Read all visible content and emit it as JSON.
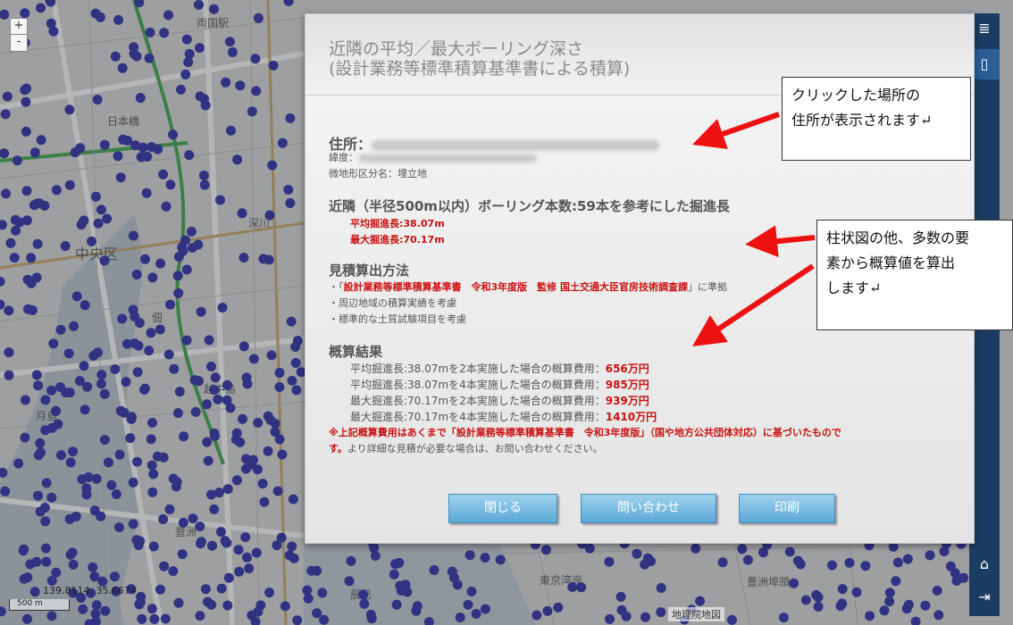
{
  "map": {
    "zoom_in": "+",
    "zoom_out": "-",
    "coordinates": "139.8114, 35.6674",
    "scale": "500 m",
    "attribution": "地理院地図",
    "labels": [
      "両国駅",
      "日本橋",
      "中央区",
      "深川",
      "佃",
      "月島",
      "越中島",
      "豊洲",
      "辰巳",
      "東京湾岸",
      "豊洲埠頭"
    ]
  },
  "sidebar": {
    "layers_icon": "≣",
    "mouse_icon": "▯",
    "home_icon": "⌂",
    "logout_icon": "⇥"
  },
  "dialog": {
    "title_line1": "近隣の平均／最大ボーリング深さ",
    "title_line2": "(設計業務等標準積算基準書による積算)",
    "address_label": "住所：",
    "latlon_label": "緯度：",
    "terrain_label": "微地形区分名：埋立地",
    "nearby_heading": "近隣（半径500m以内）ボーリング本数:59本を参考にした掘進長",
    "avg_depth": "平均掘進長:38.07m",
    "max_depth": "最大掘進長:70.17m",
    "method_heading": "見積算出方法",
    "method_items": [
      {
        "pre": "・「",
        "red": "設計業務等標準積算基準書　令和3年度版　監修 国土交通大臣官房技術調査課",
        "post": "」に準拠"
      },
      {
        "pre": "・周辺地域の積算実績を考慮",
        "red": "",
        "post": ""
      },
      {
        "pre": "・標準的な土質試験項目を考慮",
        "red": "",
        "post": ""
      }
    ],
    "result_heading": "概算結果",
    "results": [
      {
        "label": "平均掘進長:38.07mを2本実施した場合の概算費用：",
        "value": "656万円"
      },
      {
        "label": "平均掘進長:38.07mを4本実施した場合の概算費用：",
        "value": "985万円"
      },
      {
        "label": "最大掘進長:70.17mを2本実施した場合の概算費用：",
        "value": "939万円"
      },
      {
        "label": "最大掘進長:70.17mを4本実施した場合の概算費用：",
        "value": "1410万円"
      }
    ],
    "note_red_1": "※上記概算費用はあくまで「設計業務等標準積算基準書　令和3年度版」（国や地方公共団体対応）に基づいたもので",
    "note_red_2": "す。",
    "note_plain": "より詳細な見積が必要な場合は、お問い合わせください。",
    "buttons": {
      "close": "閉じる",
      "contact": "問い合わせ",
      "print": "印刷"
    }
  },
  "callouts": {
    "address": {
      "line1": "クリックした場所の",
      "line2": "住所が表示されます↵"
    },
    "estimate": {
      "line1": "柱状図の他、多数の要",
      "line2": "素から概算値を算出",
      "line3": "します↵"
    }
  },
  "colors": {
    "accent_red": "#cc1111",
    "button_blue": "#5aa8d6",
    "sidebar_navy": "#1c3d63",
    "boring_dot": "#2a2aa8"
  }
}
